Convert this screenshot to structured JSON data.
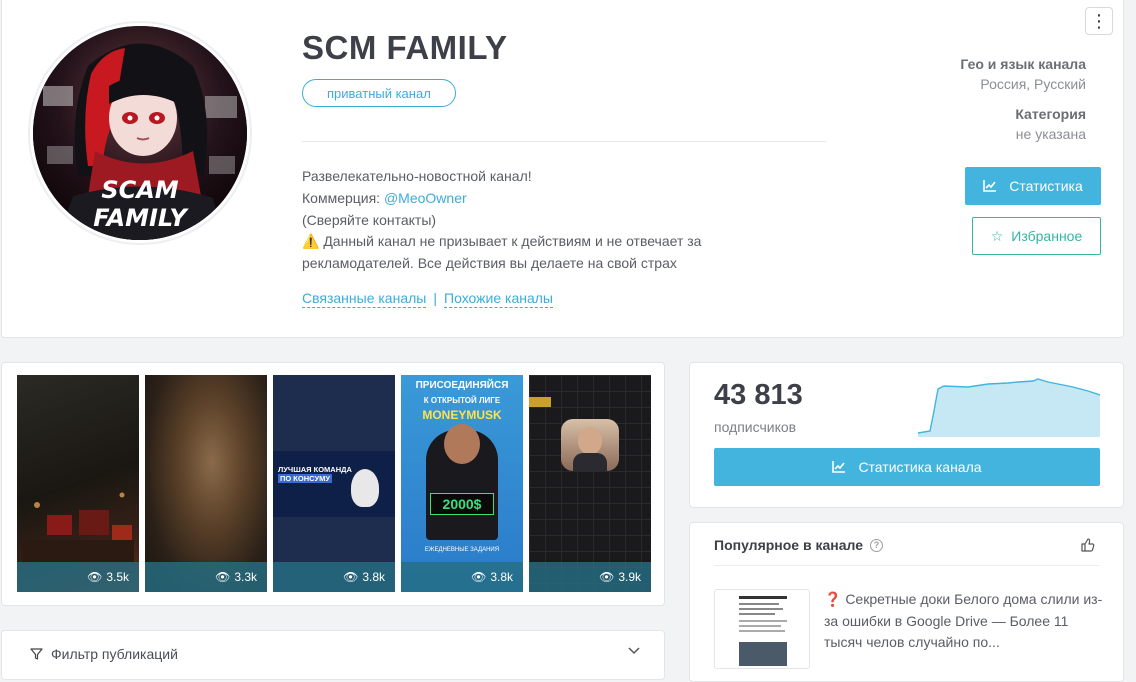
{
  "channel": {
    "title": "SCM FAMILY",
    "badge": "приватный канал",
    "avatar_text": [
      "SCAM",
      "FAMILY"
    ],
    "description": {
      "line1": "Развелекательно-новостной канал!",
      "commerce_label": "Коммерция: ",
      "commerce_link": "@MeoOwner",
      "line3": "(Сверяйте контакты)",
      "warning_icon": "⚠️",
      "warning": "Данный канал не призывает к действиям и не отвечает за рекламодателей. Все действия вы делаете на свой страх"
    },
    "links": {
      "related": "Связанные каналы",
      "separator": "|",
      "similar": "Похожие каналы"
    }
  },
  "meta": {
    "geo_label": "Гео и язык канала",
    "geo_value": "Россия, Русский",
    "category_label": "Категория",
    "category_value": "не указана"
  },
  "buttons": {
    "stats": "Статистика",
    "favorite": "Избранное",
    "channel_stats": "Статистика канала"
  },
  "stories": [
    {
      "views": "3.5k"
    },
    {
      "views": "3.3k"
    },
    {
      "views": "3.8k",
      "text": [
        "ЛУЧШАЯ КОМАНДА",
        "ПО КОНСУМУ"
      ]
    },
    {
      "views": "3.8k",
      "text": [
        "ПРИСОЕДИНЯЙСЯ",
        "К ОТКРЫТОЙ ЛИГЕ",
        "MONEYMUSK",
        "2000$",
        "ЕЖЕДНЕВНЫЕ ЗАДАНИЯ"
      ]
    },
    {
      "views": "3.9k"
    }
  ],
  "subscribers": {
    "count": "43 813",
    "label": "подписчиков"
  },
  "popular": {
    "title": "Популярное в канале",
    "post_text": "❓ Секретные доки Белого дома слили из-за ошибки в Google Drive — Более 11 тысяч челов случайно по..."
  },
  "filter": {
    "label": "Фильтр публикаций"
  },
  "colors": {
    "accent": "#42b4de",
    "favorite": "#34b6a4",
    "views_overlay": "#266e82"
  }
}
